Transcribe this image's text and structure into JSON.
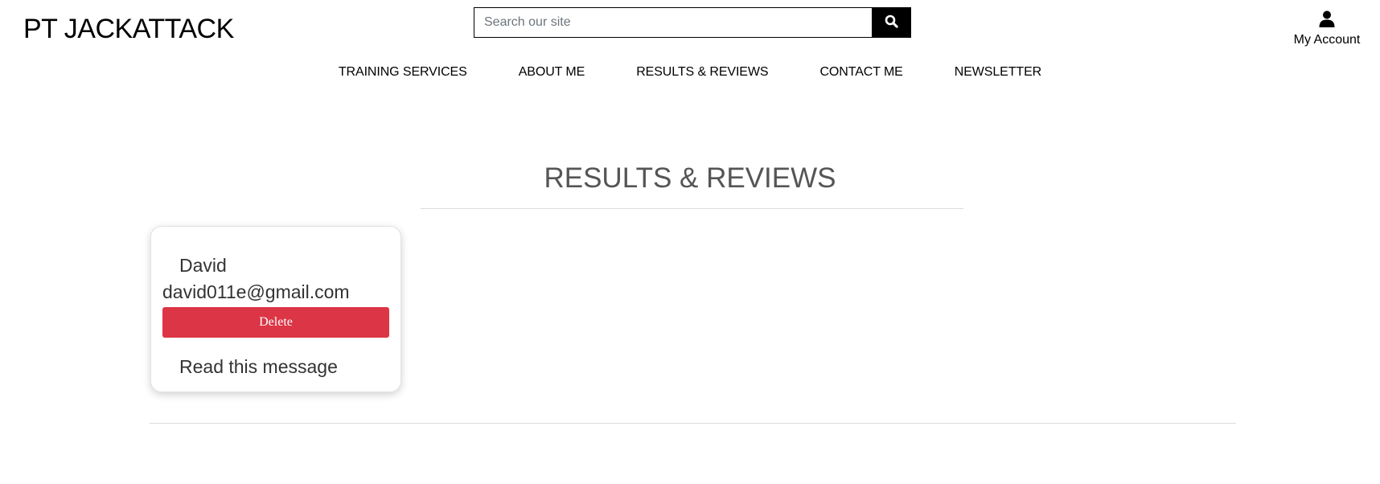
{
  "header": {
    "brand": "PT JACKATTACK",
    "search": {
      "placeholder": "Search our site",
      "button_icon": "search-icon"
    },
    "account": {
      "label": "My Account",
      "icon": "user-icon"
    }
  },
  "nav": {
    "items": [
      {
        "label": "TRAINING SERVICES"
      },
      {
        "label": "ABOUT ME"
      },
      {
        "label": "RESULTS & REVIEWS"
      },
      {
        "label": "CONTACT ME"
      },
      {
        "label": "NEWSLETTER"
      }
    ]
  },
  "main": {
    "title": "RESULTS & REVIEWS",
    "messages": [
      {
        "name": "David",
        "email": "david011e@gmail.com",
        "delete_label": "Delete",
        "read_label": "Read this message"
      }
    ]
  },
  "colors": {
    "delete": "#dc3545",
    "brand_text": "#000000",
    "title_text": "#555555"
  }
}
